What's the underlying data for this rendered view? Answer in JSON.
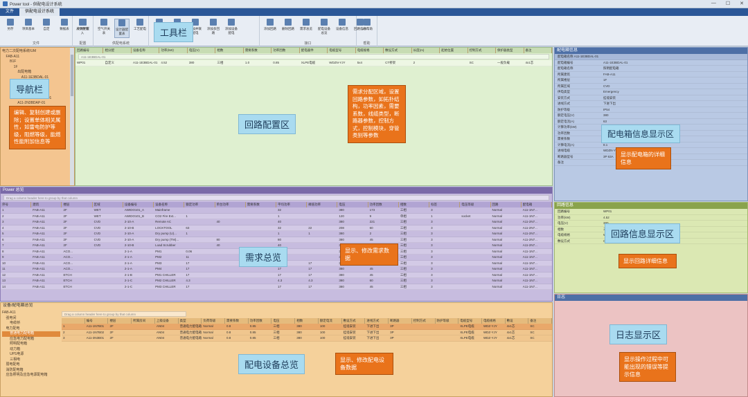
{
  "window": {
    "title": "Power tool - 供配电设计系统",
    "controls": [
      "—",
      "☐",
      "✕"
    ]
  },
  "menu": {
    "tabs": [
      "文件",
      "供配电设计系统"
    ],
    "active": 1
  },
  "toolbar": {
    "groups": [
      {
        "label": "文件",
        "buttons": [
          "另存",
          "项目基本\nDefault",
          "自定",
          "数据表",
          "从文件导入"
        ]
      },
      {
        "label": "配置",
        "buttons": [
          "项目配置"
        ]
      },
      {
        "label": "供配电系统",
        "buttons": [
          "空气开关表",
          "设计器配置表",
          "工艺配电"
        ]
      },
      {
        "label": "",
        "buttons": [
          "回路",
          "添加回路",
          "添加并联配电",
          "添加多回路",
          "添加设备配电"
        ]
      },
      {
        "label": "接口",
        "buttons": [
          "添加回路",
          "删除回路",
          "需求总览",
          "配电设备总览",
          "设备信息",
          "回路信息"
        ]
      },
      {
        "label": "帮助",
        "buttons": [
          "UM帮助"
        ]
      }
    ]
  },
  "labels": {
    "toolbar": "工具栏",
    "nav": "导航栏",
    "circuit_config": "回路配置区",
    "box_info": "配电箱信息显示区",
    "demand": "需求总览",
    "circuit_info": "回路信息显示区",
    "equipment": "配电设备总览",
    "log": "日志显示区"
  },
  "callouts": {
    "nav": "编辑、复制创建或删除；设置单体相关属性，如雷电防护等级，阻燃等级，能燃性能附加信息等",
    "circuit_config": "需求分配区域，设置回路参数，如拓扑结构，功率因素，需要系数，线缆类型，断路器参数，控制方式，控制模块，穿管类别等参数",
    "box_info": "显示配电箱的详细信息",
    "demand": "显示、修改需求数据",
    "circuit_info": "显示回路详细信息",
    "equipment": "显示、修改配电设备数据",
    "log": "显示操作过程中可能出现的错误等提示信息"
  },
  "nav_tree": [
    "电力二次配电系统/UM",
    "  FAB-A11",
    "    B1F",
    "      1F",
    "        出配电箱",
    "          A11-1E3BDAL-01",
    "          A11-1E3BDAP-01",
    "        A11-1E3BDAL-02",
    "      2F",
    "        A11-2F-DBDBDAP-01",
    "        A11-2N3BDAP-01",
    "        出配电箱"
  ],
  "circuit_header": [
    "回路编号",
    "相分配",
    "设备名称",
    "功率(kW)",
    "电压(V)",
    "相数",
    "需要系数",
    "功率因数",
    "配电器件",
    "电缆型号",
    "电缆规格",
    "敷设方式",
    "长度(m)",
    "起始位置",
    "控制方式",
    "保护器类型",
    "备注"
  ],
  "circuit_rows": [
    [
      "WP01",
      "自定义",
      "A11-1E3BDAL-01",
      "4.52",
      "380",
      "三相",
      "1.0",
      "0.85",
      "XLPE电缆",
      "WDZN-YJY",
      "5x4",
      "CT桥架",
      "2",
      "",
      "SC",
      "一般负载",
      "4x1芯"
    ]
  ],
  "demand": {
    "title": "Power 总览",
    "filter": "Drag a column header here to group by that column",
    "header": [
      "序号",
      "建筑",
      "楼层",
      "区域",
      "设备编号",
      "设备名称",
      "额定功率",
      "单台功率",
      "需要系数",
      "平均功率",
      "峰值功率",
      "电压",
      "功率因数",
      "相数",
      "标签",
      "电压等级",
      "回路",
      "配电箱"
    ],
    "rows": [
      [
        "1",
        "FAB-A11",
        "2F",
        "WET",
        "AWIDO101_A",
        "Mainframe",
        "",
        "",
        "",
        "32",
        "",
        "380",
        "173",
        "三相",
        "3",
        "",
        "Normal",
        "A11-1N7..."
      ],
      [
        "2",
        "FAB-A11",
        "2F",
        "WET",
        "AWIDO101_B",
        "CO2 Fire Ext...",
        "1",
        "",
        "",
        "1",
        "",
        "120",
        "9",
        "单相",
        "1",
        "socket",
        "Normal",
        "A11-1N7..."
      ],
      [
        "3",
        "FAB-A11",
        "2F",
        "CVD",
        "2-10-A",
        "Remote AC",
        "",
        "40",
        "",
        "40",
        "",
        "380",
        "221",
        "三相",
        "3",
        "",
        "Normal",
        "A11-2N7..."
      ],
      [
        "4",
        "FAB-A11",
        "2F",
        "CVD",
        "2-10-B",
        "LOCKTOOL",
        "63",
        "",
        "",
        "32",
        "22",
        "208",
        "60",
        "三相",
        "3",
        "",
        "Normal",
        "A11-2N7..."
      ],
      [
        "5",
        "FAB-A11",
        "2F",
        "CVD",
        "2-10-A",
        "Dry pump (U)...",
        "1",
        "",
        "",
        "1",
        "1",
        "380",
        "2",
        "三相",
        "3",
        "",
        "Normal",
        "A11-2N7..."
      ],
      [
        "6",
        "FAB-A11",
        "2F",
        "CVD",
        "2-10-A",
        "Dry pump (TM)...",
        "",
        "80",
        "",
        "80",
        "",
        "380",
        "45",
        "三相",
        "3",
        "",
        "Normal",
        "A11-2N7..."
      ],
      [
        "7",
        "FAB-A11",
        "2F",
        "CVD",
        "2-10-B",
        "Load Scrubber",
        "",
        "40",
        "",
        "40",
        "",
        "380",
        "45",
        "三相",
        "3",
        "",
        "Normal",
        "A11-2N7..."
      ],
      [
        "8",
        "FAB-A11",
        "ACO...",
        "",
        "2-1-A",
        "PM1",
        "0.06",
        "",
        "",
        "0.06",
        "",
        "380",
        "",
        "三相",
        "3",
        "",
        "Normal",
        "A11-1N7..."
      ],
      [
        "9",
        "FAB-A11",
        "ACO...",
        "",
        "2-1-A",
        "PM2",
        "11",
        "",
        "",
        "8",
        "",
        "380",
        "45",
        "三相",
        "3",
        "",
        "Normal",
        "A11-1N7..."
      ],
      [
        "10",
        "FAB-A11",
        "ACO...",
        "",
        "2-1-A",
        "PM3",
        "17",
        "",
        "",
        "17",
        "17",
        "380",
        "45",
        "三相",
        "3",
        "",
        "Normal",
        "A11-1N7..."
      ],
      [
        "11",
        "FAB-A11",
        "ACO...",
        "",
        "2-1-A",
        "PM4",
        "17",
        "",
        "",
        "17",
        "17",
        "380",
        "45",
        "三相",
        "3",
        "",
        "Normal",
        "A11-1N7..."
      ],
      [
        "12",
        "FAB-A11",
        "ETCH",
        "",
        "2-1-B",
        "PM1 CHILLER",
        "17",
        "",
        "",
        "17",
        "17",
        "380",
        "45",
        "三相",
        "3",
        "",
        "Normal",
        "A11-1N7..."
      ],
      [
        "13",
        "FAB-A11",
        "ETCH",
        "",
        "2-1-C",
        "PM2 CHILLER",
        "4.3",
        "",
        "",
        "4.3",
        "4.3",
        "380",
        "60",
        "三相",
        "3",
        "",
        "Normal",
        "A11-1N7..."
      ],
      [
        "14",
        "FAB-A11",
        "ETCH",
        "",
        "2-1-C",
        "PM3 CHILLER",
        "17",
        "",
        "",
        "17",
        "17",
        "380",
        "45",
        "三相",
        "3",
        "",
        "Normal",
        "A11-1N7..."
      ]
    ]
  },
  "box_info": {
    "title": "配电箱信息",
    "subtitle": "配电箱名称  A11-1E3BDAL-01",
    "rows": [
      [
        "配电箱编号",
        "A11-1E3BDAL-01"
      ],
      [
        "配电箱名称",
        "照明配电箱"
      ],
      [
        "所属建筑",
        "FAB-A11"
      ],
      [
        "所属楼层",
        "1F"
      ],
      [
        "所属区域",
        "CVD"
      ],
      [
        "供电类型",
        "Emergency"
      ],
      [
        "安装方式",
        "挂墙安装"
      ],
      [
        "进线方式",
        "下进下出"
      ],
      [
        "防护等级",
        "IP54"
      ],
      [
        "额定电压(V)",
        "380"
      ],
      [
        "额定电流(A)",
        "63"
      ],
      [
        "计算功率(kW)",
        "4.52"
      ],
      [
        "功率因数",
        "0.85"
      ],
      [
        "需要系数",
        "1.0"
      ],
      [
        "计算电流(A)",
        "8.1"
      ],
      [
        "进线电缆",
        "WDZN-YJY 5x4"
      ],
      [
        "断路器型号",
        "3P 63A"
      ],
      [
        "备注",
        ""
      ]
    ]
  },
  "circuit_info": {
    "title": "回路信息",
    "rows": [
      [
        "回路编号",
        "WP01"
      ],
      [
        "功率(kW)",
        "4.52"
      ],
      [
        "电压(V)",
        "380"
      ],
      [
        "相数",
        "三相"
      ],
      [
        "电缆规格",
        "WDZN-YJY 5x4 CT"
      ],
      [
        "敷设方式",
        "CT桥架"
      ]
    ]
  },
  "equipment": {
    "title": "设备/配电箱总览",
    "filter": "Drag a column header here to group by that column",
    "tree": [
      "FAB-A11",
      "  强电间",
      "    电缆桥",
      "  电力配电",
      "    普通电力配电箱",
      "    应急电力配电箱",
      "    照明配电箱",
      "    动力箱",
      "    UPS电源",
      "    三相电",
      "  弱电配电",
      "  消防配电箱",
      "  应急照明及应急电源配电箱"
    ],
    "header": [
      "",
      "编号",
      "楼层",
      "所属房间",
      "上级设备",
      "类型",
      "负荷等级",
      "需要系数",
      "功率因数",
      "电压",
      "相数",
      "额定电流",
      "敷设方式",
      "进线方式",
      "断路器",
      "控制方式",
      "防护等级",
      "电缆型号",
      "电缆规格",
      "敷设",
      "备注"
    ],
    "rows": [
      [
        "1",
        "A11-1N7B01",
        "2F",
        "",
        "AN04",
        "普通电力配电箱",
        "Normal",
        "0.8",
        "0.85",
        "三相",
        "380",
        "100",
        "挂墙安装",
        "下进下出",
        "3P",
        "",
        "",
        "XLPE电缆",
        "WDZ-YJY",
        "4x1芯",
        "SC"
      ],
      [
        "2",
        "A11-1N7B02",
        "2F",
        "",
        "AN04",
        "普通电力配电箱",
        "Normal",
        "0.8",
        "0.85",
        "三相",
        "380",
        "100",
        "挂墙安装",
        "下进下出",
        "3P",
        "",
        "",
        "XLPE电缆",
        "WDZ-YJY",
        "4x1芯",
        "SC"
      ],
      [
        "3",
        "A11-3N3B01",
        "2F",
        "",
        "AN04",
        "普通电力配电箱",
        "Normal",
        "0.8",
        "0.85",
        "三相",
        "380",
        "100",
        "挂墙安装",
        "下进下出",
        "3P",
        "",
        "",
        "XLPE电缆",
        "WDZ-YJY",
        "4x1芯",
        "SC"
      ]
    ]
  },
  "log": {
    "title": "日志"
  },
  "colors": {
    "nav_bg": "#f4c590",
    "circuit_bg": "#dff0d0",
    "demand_bg": "#c7bcdf",
    "info_bg": "#b9c9e4",
    "circuit_info_bg": "#dbe8b3",
    "equipment_bg": "#f5d19b",
    "log_bg": "#ecc3c3",
    "callout": "#e9731b",
    "label": "#a9dbf0"
  }
}
